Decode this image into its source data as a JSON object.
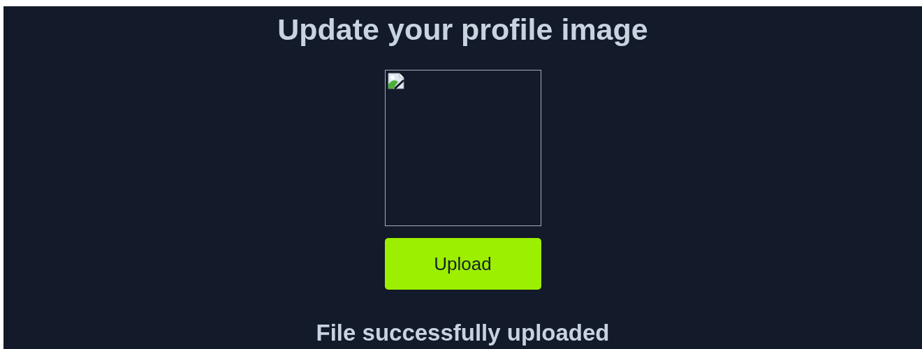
{
  "title": "Update your profile image",
  "upload_button": {
    "label": "Upload"
  },
  "status_message": "File successfully uploaded"
}
